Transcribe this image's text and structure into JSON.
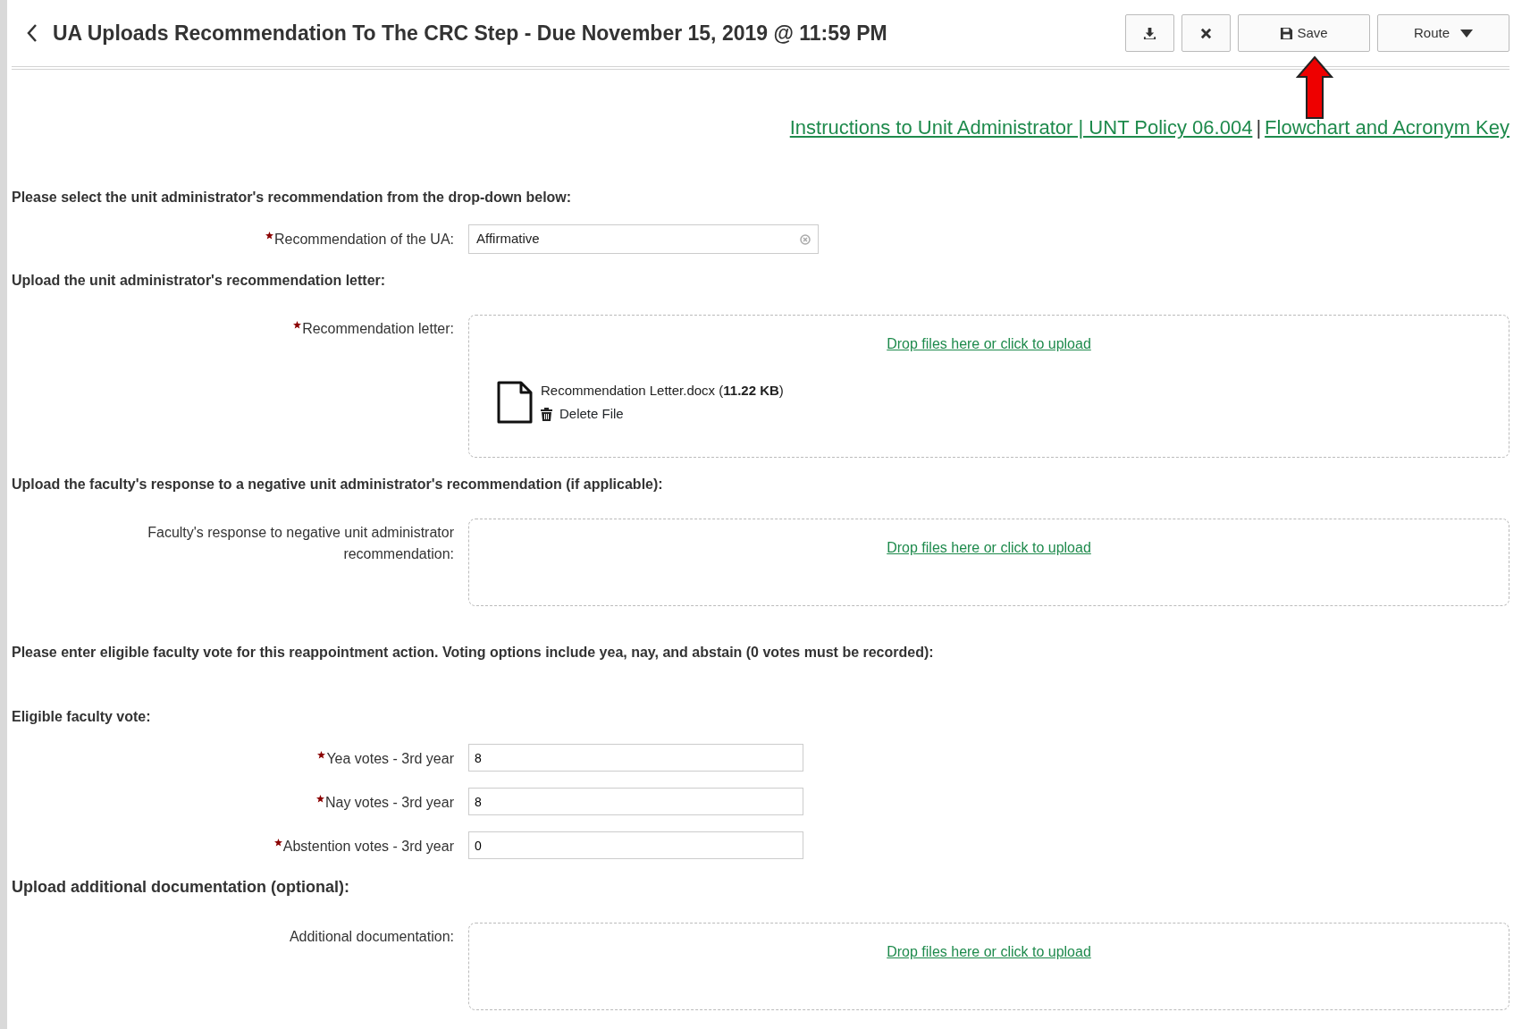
{
  "header": {
    "title": "UA Uploads Recommendation To The CRC Step - Due November 15, 2019 @ 11:59 PM",
    "buttons": [
      {
        "kind": "download"
      },
      {
        "kind": "close"
      },
      {
        "kind": "save",
        "label": "Save"
      },
      {
        "kind": "route",
        "label": "Route"
      }
    ]
  },
  "links": {
    "items": [
      "Instructions to Unit Administrator | UNT Policy 06.004",
      "Flowchart and Acronym Key"
    ],
    "separator": "|"
  },
  "sections": [
    {
      "heading": "Please select the unit administrator's recommendation from the drop-down below:",
      "large": false,
      "fields": [
        {
          "kind": "select",
          "label": "Recommendation of the UA:",
          "required": true,
          "value": "Affirmative"
        }
      ]
    },
    {
      "heading": "Upload the unit administrator's recommendation letter:",
      "large": false,
      "fields": [
        {
          "kind": "upload",
          "label": "Recommendation letter:",
          "required": true,
          "prompt": "Drop files here or click to upload",
          "files": [
            {
              "name": "Recommendation Letter.docx (**11.22 KB**)",
              "delete": "Delete File"
            }
          ]
        }
      ]
    },
    {
      "heading": "Upload the faculty's response to a negative unit administrator's recommendation (if applicable):",
      "large": false,
      "fields": [
        {
          "kind": "upload",
          "label": "Faculty's response to negative unit administrator recommendation:",
          "required": false,
          "prompt": "Drop files here or click to upload"
        }
      ]
    },
    {
      "heading": "Please enter eligible faculty vote for this reappointment action.  Voting options include yea, nay, and abstain (0 votes must be recorded):",
      "large": false
    },
    {
      "heading": "Eligible faculty vote:",
      "large": false,
      "fields": [
        {
          "kind": "text",
          "label": "Yea votes - 3rd year",
          "required": true,
          "value": "8"
        },
        {
          "kind": "text",
          "label": "Nay votes - 3rd year",
          "required": true,
          "value": "8"
        },
        {
          "kind": "text",
          "label": "Abstention votes - 3rd year",
          "required": true,
          "value": "0"
        }
      ]
    },
    {
      "heading": "Upload additional documentation (optional):",
      "large": true,
      "fields": [
        {
          "kind": "upload",
          "label": "Additional documentation:",
          "required": false,
          "prompt": "Drop files here or click to upload"
        }
      ]
    }
  ]
}
